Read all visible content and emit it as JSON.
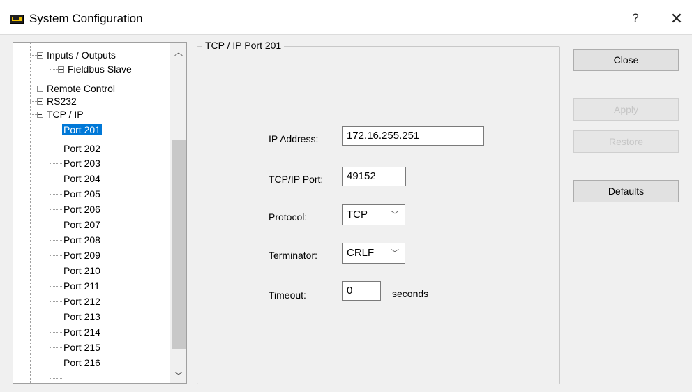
{
  "window": {
    "title": "System Configuration",
    "help_glyph": "?",
    "close_glyph": "✕"
  },
  "tree": {
    "items": [
      {
        "label": "Inputs / Outputs",
        "expander": "minus"
      },
      {
        "label": "Fieldbus Slave",
        "expander": "plus"
      },
      {
        "label": "Remote Control",
        "expander": "plus"
      },
      {
        "label": "RS232",
        "expander": "plus"
      },
      {
        "label": "TCP / IP",
        "expander": "minus"
      },
      {
        "label": "Port 201",
        "selected": true
      },
      {
        "label": "Port 202"
      },
      {
        "label": "Port 203"
      },
      {
        "label": "Port 204"
      },
      {
        "label": "Port 205"
      },
      {
        "label": "Port 206"
      },
      {
        "label": "Port 207"
      },
      {
        "label": "Port 208"
      },
      {
        "label": "Port 209"
      },
      {
        "label": "Port 210"
      },
      {
        "label": "Port 211"
      },
      {
        "label": "Port 212"
      },
      {
        "label": "Port 213"
      },
      {
        "label": "Port 214"
      },
      {
        "label": "Port 215"
      },
      {
        "label": "Port 216"
      }
    ],
    "scroll_up_glyph": "︿",
    "scroll_down_glyph": "﹀"
  },
  "group": {
    "title": "TCP / IP Port 201",
    "ip_label": "IP Address:",
    "ip_value": "172.16.255.251",
    "port_label": "TCP/IP Port:",
    "port_value": "49152",
    "protocol_label": "Protocol:",
    "protocol_value": "TCP",
    "terminator_label": "Terminator:",
    "terminator_value": "CRLF",
    "timeout_label": "Timeout:",
    "timeout_value": "0",
    "timeout_unit": "seconds",
    "dropdown_glyph": "﹀"
  },
  "buttons": {
    "close": "Close",
    "apply": "Apply",
    "restore": "Restore",
    "defaults": "Defaults"
  }
}
